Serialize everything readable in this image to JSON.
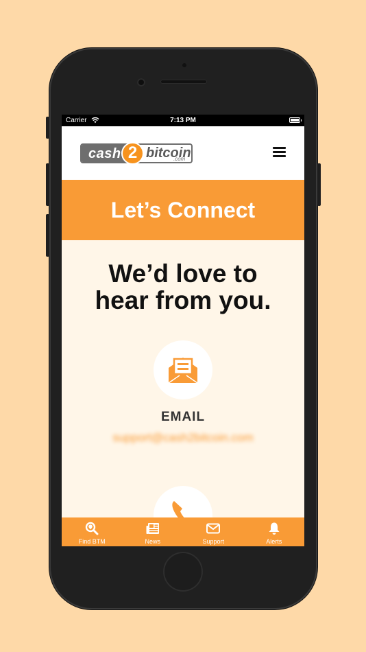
{
  "status_bar": {
    "carrier": "Carrier",
    "time": "7:13 PM"
  },
  "logo": {
    "left_word": "cash",
    "coin_glyph": "2",
    "right_word": "bitcoin",
    "suffix": ".com"
  },
  "hero": {
    "title": "Let’s Connect"
  },
  "main": {
    "headline_line1": "We’d love to",
    "headline_line2": "hear from you.",
    "email": {
      "label": "EMAIL",
      "address": "support@cash2bitcoin.com",
      "icon": "envelope-icon"
    },
    "phone": {
      "icon": "phone-icon"
    }
  },
  "tabbar": {
    "tabs": [
      {
        "label": "Find BTM",
        "icon": "search-location-icon"
      },
      {
        "label": "News",
        "icon": "newspaper-icon"
      },
      {
        "label": "Support",
        "icon": "envelope-icon"
      },
      {
        "label": "Alerts",
        "icon": "bell-icon"
      }
    ]
  },
  "colors": {
    "accent": "#f99b36",
    "page_background": "#fed9a8",
    "screen_background": "#fff6e8",
    "logo_gray": "#6e6e6e"
  }
}
